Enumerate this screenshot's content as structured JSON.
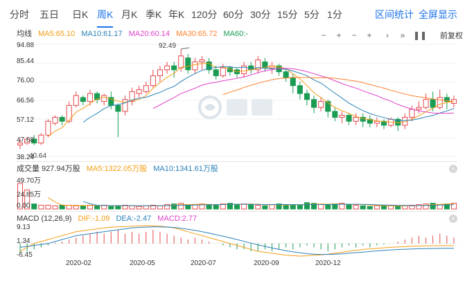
{
  "tabs": {
    "items": [
      "分时",
      "五日",
      "日K",
      "周K",
      "月K",
      "季K",
      "年K",
      "120分",
      "60分",
      "30分",
      "15分",
      "5分",
      "1分"
    ],
    "active": "周K",
    "right_links": [
      "区间统计",
      "全屏显示"
    ]
  },
  "main_legend": {
    "avg_label": "均线",
    "ma5": "MA5:65.10",
    "ma10": "MA10:61.17",
    "ma20": "MA20:60.14",
    "ma30": "MA30:65.72",
    "ma60": "MA60:-",
    "fuquan": "前复权",
    "controls": [
      "minus",
      "plus",
      "minus",
      "plus",
      "right",
      "right-end",
      "pause"
    ]
  },
  "volume_legend": {
    "title": "成交量 927.94万股",
    "ma5": "MA5:1322.05万股",
    "ma10": "MA10:1341.61万股"
  },
  "macd_legend": {
    "title": "MACD (12,26,9)",
    "dif": "DIF:-1.09",
    "dea": "DEA:-2.47",
    "macd": "MACD:2.77"
  },
  "price_axis": [
    "94.88",
    "85.44",
    "76.00",
    "66.56",
    "57.12",
    "47.68",
    "38.24"
  ],
  "price_marks": {
    "high": "92.49",
    "low": "40.64"
  },
  "volume_axis": [
    "49.70万",
    "24.85万",
    "0.00"
  ],
  "macd_axis": [
    "9.13",
    "1.34",
    "-6.45"
  ],
  "x_axis": [
    "2020-02",
    "2020-05",
    "2020-07",
    "2020-09",
    "2020-12"
  ],
  "colors": {
    "up": "#e6464b",
    "down": "#1a9c52",
    "ma5": "#f39c12",
    "ma10": "#2980b9",
    "ma20": "#e040c8",
    "ma30": "#ff7f2a",
    "accent": "#1a73e8"
  },
  "chart_data": {
    "type": "candlestick",
    "ylim": [
      38.24,
      94.88
    ],
    "candles": [
      [
        44,
        45,
        42,
        47
      ],
      [
        45,
        47,
        44,
        48
      ],
      [
        47,
        45,
        44,
        49
      ],
      [
        45,
        49,
        44,
        50
      ],
      [
        49,
        56,
        48,
        57
      ],
      [
        55,
        58,
        54,
        59
      ],
      [
        58,
        56,
        54,
        59
      ],
      [
        56,
        64,
        55,
        66
      ],
      [
        64,
        69,
        63,
        71
      ],
      [
        68,
        66,
        64,
        69
      ],
      [
        66,
        70,
        64,
        72
      ],
      [
        70,
        67,
        65,
        71
      ],
      [
        66,
        69,
        64,
        70
      ],
      [
        68,
        64,
        62,
        71
      ],
      [
        64,
        61,
        48,
        65
      ],
      [
        61,
        67,
        59,
        69
      ],
      [
        66,
        71,
        64,
        73
      ],
      [
        70,
        72,
        68,
        74
      ],
      [
        71,
        74,
        70,
        76
      ],
      [
        74,
        79,
        73,
        82
      ],
      [
        79,
        82,
        76,
        84
      ],
      [
        82,
        84,
        80,
        86
      ],
      [
        84,
        82,
        78,
        86
      ],
      [
        83,
        89,
        81,
        92.49
      ],
      [
        88,
        82,
        80,
        90
      ],
      [
        82,
        86,
        80,
        88
      ],
      [
        86,
        87,
        82,
        89
      ],
      [
        86,
        82,
        80,
        88
      ],
      [
        82,
        79,
        77,
        84
      ],
      [
        79,
        83,
        78,
        85
      ],
      [
        83,
        81,
        79,
        84
      ],
      [
        82,
        80,
        78,
        83
      ],
      [
        80,
        84,
        78,
        86
      ],
      [
        84,
        82,
        80,
        86
      ],
      [
        82,
        87,
        80,
        89
      ],
      [
        86,
        83,
        81,
        88
      ],
      [
        83,
        84,
        80,
        86
      ],
      [
        84,
        81,
        79,
        85
      ],
      [
        81,
        78,
        76,
        82
      ],
      [
        78,
        74,
        70,
        80
      ],
      [
        74,
        70,
        67,
        76
      ],
      [
        70,
        67,
        64,
        72
      ],
      [
        67,
        63,
        60,
        69
      ],
      [
        63,
        66,
        61,
        68
      ],
      [
        66,
        61,
        58,
        67
      ],
      [
        61,
        58,
        56,
        63
      ],
      [
        58,
        59,
        55,
        61
      ],
      [
        59,
        56,
        54,
        60
      ],
      [
        56,
        58,
        54,
        60
      ],
      [
        58,
        56,
        53,
        60
      ],
      [
        57,
        55,
        53,
        59
      ],
      [
        55,
        56,
        53,
        58
      ],
      [
        56,
        54,
        52,
        57
      ],
      [
        54,
        57,
        53,
        58
      ],
      [
        57,
        54,
        51,
        58
      ],
      [
        54,
        58,
        52,
        60
      ],
      [
        58,
        62,
        56,
        64
      ],
      [
        62,
        63,
        60,
        66
      ],
      [
        63,
        67,
        62,
        70
      ],
      [
        67,
        63,
        61,
        71
      ],
      [
        63,
        68,
        62,
        72
      ],
      [
        68,
        66,
        62,
        70
      ],
      [
        65,
        67,
        63,
        69
      ]
    ],
    "volume": [
      40,
      30,
      8,
      6,
      6,
      5,
      6,
      6,
      5,
      5,
      6,
      5,
      6,
      4,
      5,
      6,
      5,
      4,
      5,
      6,
      5,
      7,
      8,
      9,
      6,
      7,
      8,
      7,
      6,
      8,
      9,
      7,
      8,
      7,
      6,
      5,
      7,
      8,
      6,
      7,
      6,
      10,
      9,
      7,
      6,
      8,
      9,
      7,
      6,
      5,
      4,
      5,
      6,
      5,
      4,
      5,
      6,
      7,
      8,
      9,
      7,
      8,
      9
    ],
    "macd_hist": [
      -5,
      -4,
      -3,
      -2,
      -1,
      0.5,
      1,
      2,
      3,
      4,
      5,
      6,
      5,
      6,
      7,
      5,
      6,
      5,
      6,
      7,
      6,
      5,
      4,
      3,
      2,
      3,
      2,
      1,
      0,
      -1,
      -2,
      -3,
      -3,
      -4,
      -4,
      -3,
      -4,
      -3,
      -2,
      -3,
      -2,
      -1,
      -2,
      -3,
      -4,
      -3,
      -2,
      -1,
      -2,
      -1,
      -2,
      -1,
      -0.5,
      0,
      1,
      2,
      3,
      4,
      3,
      4,
      5,
      4,
      3
    ],
    "dif": [
      -4,
      -2,
      0,
      1,
      2,
      3,
      4,
      5,
      6,
      6.5,
      7,
      7.5,
      8,
      8.3,
      8.5,
      8.7,
      8.8,
      9,
      9.13,
      9,
      8.8,
      8.5,
      8,
      7,
      6,
      5,
      4,
      3,
      2,
      1,
      0,
      -1,
      -2,
      -3,
      -4,
      -4.5,
      -5,
      -5.5,
      -6,
      -6.2,
      -6.45,
      -6.3,
      -6,
      -5.8,
      -5.5,
      -5,
      -4.5,
      -4,
      -3.5,
      -3,
      -2.8,
      -2.5,
      -2.2,
      -2,
      -1.8,
      -1.6,
      -1.4,
      -1.3,
      -1.2,
      -1.15,
      -1.12,
      -1.1,
      -1.09
    ],
    "dea": [
      -2,
      -1.5,
      -1,
      -0.5,
      0,
      1,
      2,
      3,
      4,
      4.5,
      5,
      5.5,
      6,
      6.5,
      7,
      7.5,
      8,
      8.2,
      8.4,
      8.5,
      8.5,
      8.4,
      8.2,
      7.8,
      7.3,
      6.7,
      6,
      5.3,
      4.5,
      3.7,
      2.9,
      2,
      1.1,
      0.2,
      -0.7,
      -1.5,
      -2.3,
      -3,
      -3.7,
      -4.3,
      -4.8,
      -5.2,
      -5.5,
      -5.6,
      -5.6,
      -5.5,
      -5.3,
      -5,
      -4.7,
      -4.4,
      -4.1,
      -3.8,
      -3.5,
      -3.3,
      -3.1,
      -2.95,
      -2.8,
      -2.7,
      -2.62,
      -2.56,
      -2.52,
      -2.49,
      -2.47
    ]
  }
}
